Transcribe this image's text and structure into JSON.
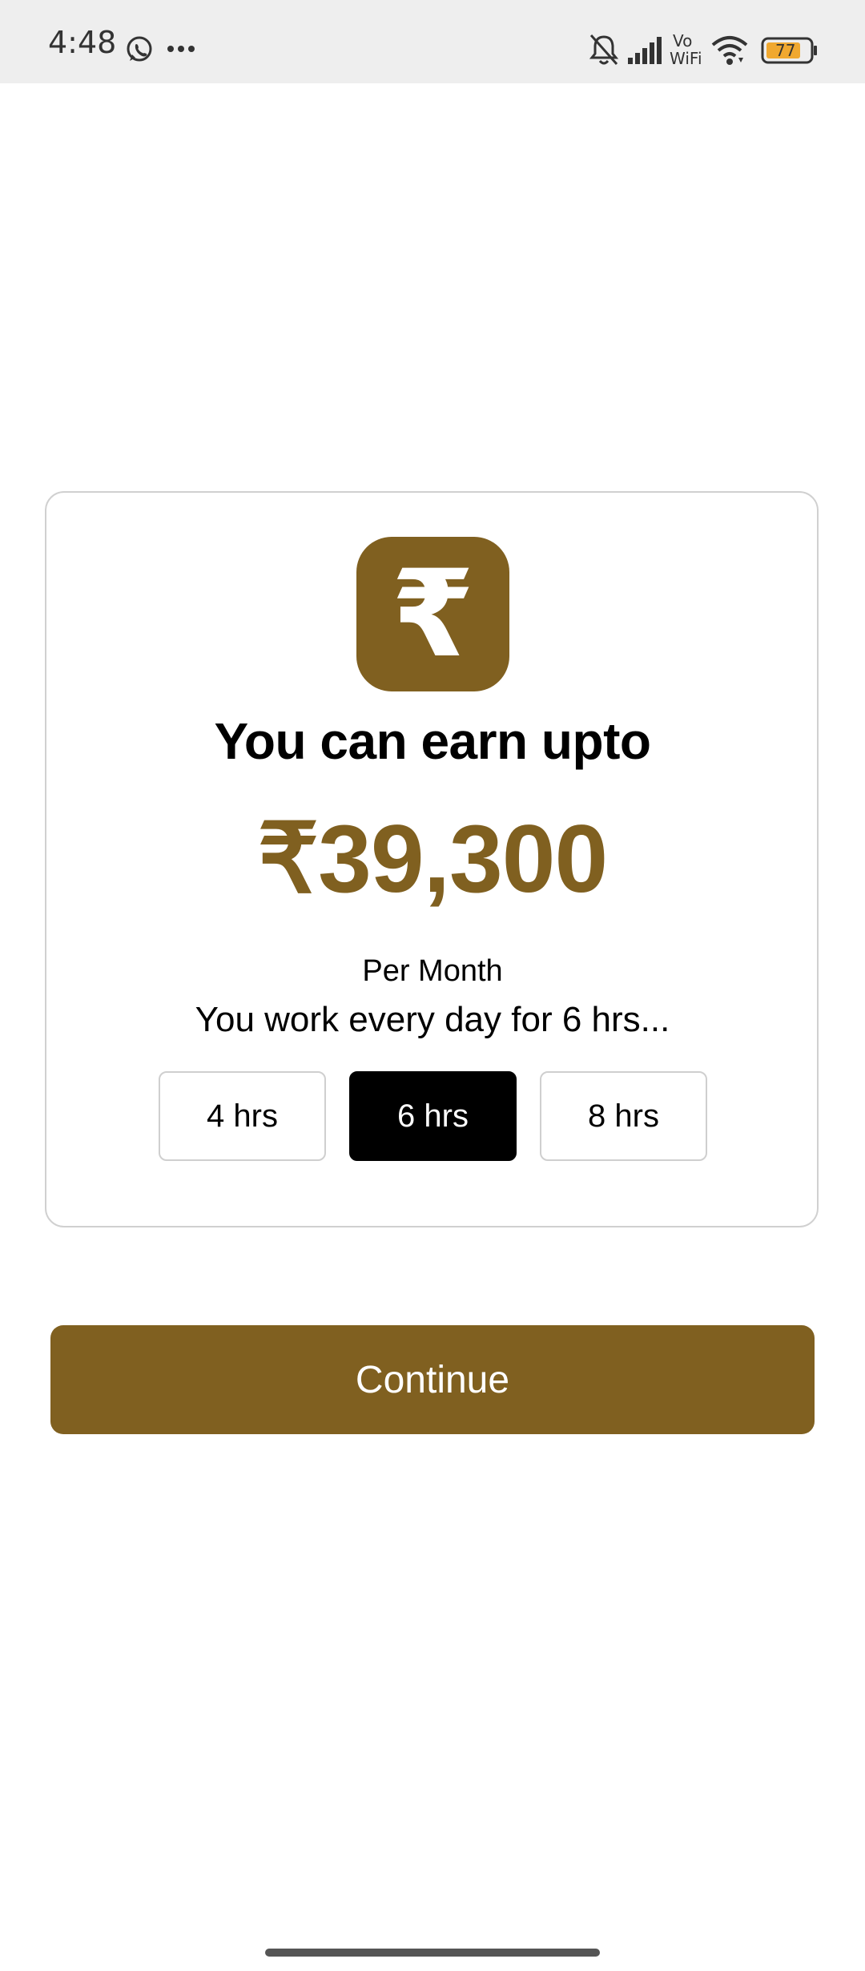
{
  "status_bar": {
    "time": "4:48",
    "battery_level": "77",
    "network_label_top": "Vo",
    "network_label_bottom": "WiFi",
    "icons": [
      "whatsapp-icon",
      "more-dots-icon",
      "bell-off-icon",
      "signal-icon",
      "vowifi-icon",
      "wifi-icon",
      "battery-icon"
    ]
  },
  "card": {
    "currency_glyph": "₹",
    "headline": "You can earn upto",
    "amount": "₹39,300",
    "period": "Per Month",
    "work_note": "You work every day for 6 hrs...",
    "hours_options": [
      "4 hrs",
      "6 hrs",
      "8 hrs"
    ],
    "selected_option": "6 hrs"
  },
  "continue_label": "Continue",
  "colors": {
    "brand": "#806020",
    "status_bar_bg": "#eeeeee",
    "selected_bg": "#000000",
    "battery_fill": "#f0a830"
  }
}
